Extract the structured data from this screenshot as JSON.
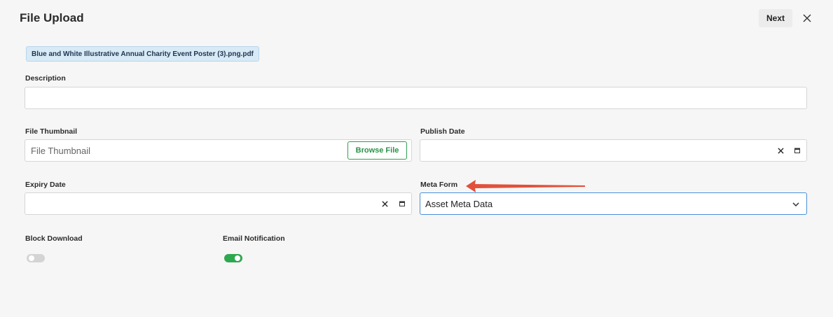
{
  "header": {
    "title": "File Upload",
    "next_label": "Next",
    "close_icon": "close-icon"
  },
  "file_chip": {
    "name": "Blue and White Illustrative Annual Charity Event Poster (3).png.pdf"
  },
  "form": {
    "description": {
      "label": "Description",
      "value": "",
      "placeholder": ""
    },
    "file_thumbnail": {
      "label": "File Thumbnail",
      "value": "",
      "placeholder": "File Thumbnail",
      "browse_label": "Browse File"
    },
    "publish_date": {
      "label": "Publish Date",
      "value": "",
      "placeholder": ""
    },
    "expiry_date": {
      "label": "Expiry Date",
      "value": "",
      "placeholder": ""
    },
    "meta_form": {
      "label": "Meta Form",
      "selected": "Asset Meta Data"
    },
    "block_download": {
      "label": "Block Download",
      "enabled": false
    },
    "email_notification": {
      "label": "Email Notification",
      "enabled": true
    }
  },
  "colors": {
    "accent_green": "#2ea84f",
    "chip_bg": "#d8eaf6",
    "focus_blue": "#4a90d9",
    "annotation_arrow": "#e2503a"
  }
}
